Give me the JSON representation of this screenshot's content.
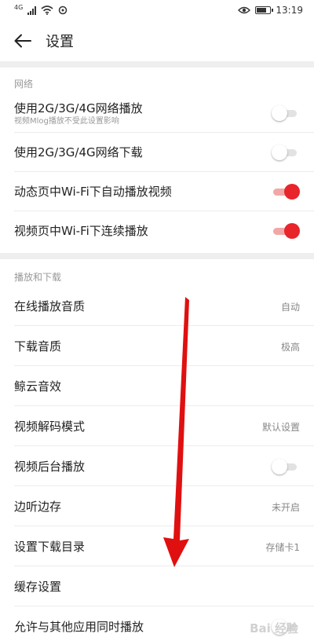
{
  "status_bar": {
    "network_type": "4G",
    "time": "13:19"
  },
  "header": {
    "title": "设置"
  },
  "sections": {
    "network": {
      "title": "网络",
      "rows": [
        {
          "label": "使用2G/3G/4G网络播放",
          "sub": "视频Mlog播放不受此设置影响",
          "toggle": "off"
        },
        {
          "label": "使用2G/3G/4G网络下载",
          "toggle": "off"
        },
        {
          "label": "动态页中Wi-Fi下自动播放视频",
          "toggle": "on"
        },
        {
          "label": "视频页中Wi-Fi下连续播放",
          "toggle": "on"
        }
      ]
    },
    "playback": {
      "title": "播放和下载",
      "rows": [
        {
          "label": "在线播放音质",
          "value": "自动"
        },
        {
          "label": "下载音质",
          "value": "极高"
        },
        {
          "label": "鲸云音效"
        },
        {
          "label": "视频解码模式",
          "value": "默认设置"
        },
        {
          "label": "视频后台播放",
          "toggle": "off"
        },
        {
          "label": "边听边存",
          "value": "未开启"
        },
        {
          "label": "设置下载目录",
          "value": "存储卡1"
        },
        {
          "label": "缓存设置"
        },
        {
          "label": "允许与其他应用同时播放",
          "toggle": "off"
        }
      ]
    }
  },
  "watermark": "Bai 经验",
  "colors": {
    "accent": "#e8252b",
    "arrow": "#e01010"
  },
  "icons": [
    "back-arrow-icon",
    "eye-icon",
    "battery-icon",
    "wifi-icon",
    "signal-icon"
  ]
}
